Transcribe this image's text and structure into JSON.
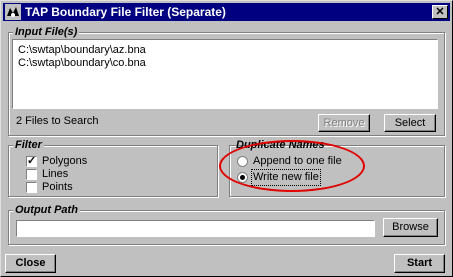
{
  "window": {
    "title": "TAP Boundary File Filter (Separate)",
    "app_icon": "tap-app-icon",
    "close_glyph": "✕"
  },
  "input_files": {
    "legend": "Input File(s)",
    "files": [
      "C:\\swtap\\boundary\\az.bna",
      "C:\\swtap\\boundary\\co.bna"
    ],
    "count_text": "2 Files to Search",
    "remove_label": "Remove",
    "select_label": "Select"
  },
  "filter": {
    "legend": "Filter",
    "options": [
      {
        "label": "Polygons",
        "checked": true
      },
      {
        "label": "Lines",
        "checked": false
      },
      {
        "label": "Points",
        "checked": false
      }
    ]
  },
  "duplicate_names": {
    "legend": "Duplicate Names",
    "options": [
      {
        "label": "Append to one file",
        "selected": false
      },
      {
        "label": "Write new file",
        "selected": true
      }
    ],
    "annotation_color": "#e00000"
  },
  "output_path": {
    "legend": "Output Path",
    "value": "",
    "browse_label": "Browse"
  },
  "footer": {
    "close_label": "Close",
    "start_label": "Start"
  }
}
